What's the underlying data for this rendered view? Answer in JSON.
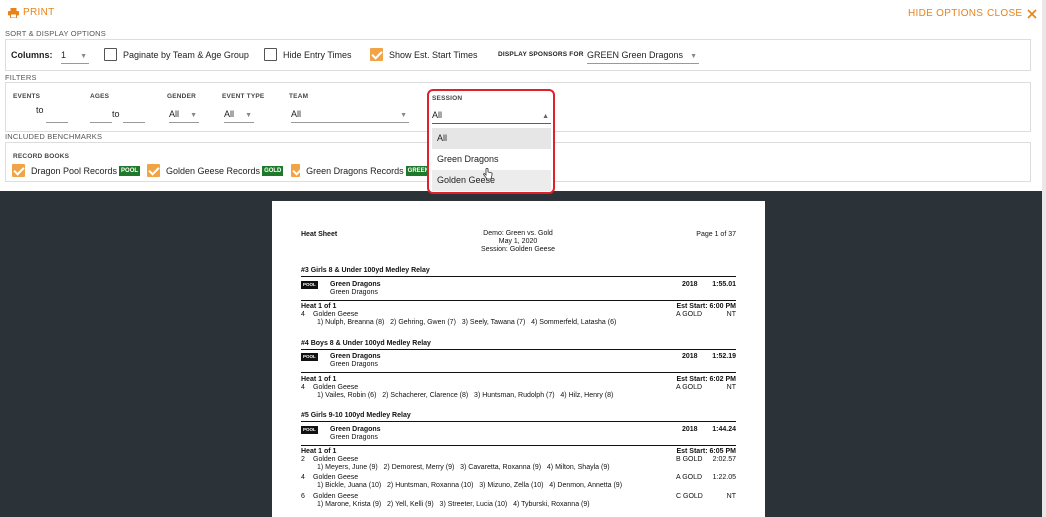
{
  "toolbar": {
    "print_label": "PRINT",
    "hide_options_label": "HIDE OPTIONS",
    "close_label": "CLOSE"
  },
  "sort_display": {
    "section_label": "SORT & DISPLAY OPTIONS",
    "columns_label": "Columns:",
    "columns_value": "1",
    "paginate_label": "Paginate by Team & Age Group",
    "paginate_checked": false,
    "hide_entry_times_label": "Hide Entry Times",
    "hide_entry_times_checked": false,
    "show_est_label": "Show Est. Start Times",
    "show_est_checked": true,
    "sponsors_label": "DISPLAY SPONSORS FOR",
    "sponsors_value": "GREEN Green Dragons"
  },
  "filters": {
    "section_label": "FILTERS",
    "events_label": "EVENTS",
    "events_to": "to",
    "ages_label": "AGES",
    "ages_to": "to",
    "gender_label": "GENDER",
    "gender_value": "All",
    "event_type_label": "EVENT TYPE",
    "event_type_value": "All",
    "team_label": "TEAM",
    "team_value": "All",
    "session_label": "SESSION",
    "session_value": "All",
    "session_options": [
      "All",
      "Green Dragons",
      "Golden Geese"
    ]
  },
  "benchmarks": {
    "section_label": "INCLUDED BENCHMARKS",
    "record_books_label": "RECORD BOOKS",
    "items": [
      {
        "label": "Dragon Pool Records",
        "tag": "POOL"
      },
      {
        "label": "Golden Geese Records",
        "tag": "GOLD"
      },
      {
        "label": "Green Dragons Records",
        "tag": "GREEN"
      }
    ]
  },
  "sheet": {
    "title": "Heat Sheet",
    "meet_name": "Demo: Green vs. Gold",
    "meet_date": "May 1, 2020",
    "session_line": "Session: Golden Geese",
    "page": "Page 1 of 37",
    "events": [
      {
        "title": "#3 Girls 8 & Under 100yd Medley Relay",
        "record_tag": "POOL",
        "record_team": "Green Dragons",
        "record_team2": "Green Dragons",
        "record_year": "2018",
        "record_time": "1:55.01",
        "heat": "Heat 1 of 1",
        "est_start": "Est Start: 6:00 PM",
        "lanes": [
          {
            "lane": "4",
            "team": "Golden Geese",
            "entry": "A GOLD",
            "time": "NT",
            "swimmers": "1) Nulph, Breanna (8)   2) Gehring, Gwen (7)   3) Seely, Tawana (7)   4) Sommerfeld, Latasha (6)"
          }
        ]
      },
      {
        "title": "#4 Boys 8 & Under 100yd Medley Relay",
        "record_tag": "POOL",
        "record_team": "Green Dragons",
        "record_team2": "Green Dragons",
        "record_year": "2018",
        "record_time": "1:52.19",
        "heat": "Heat 1 of 1",
        "est_start": "Est Start: 6:02 PM",
        "lanes": [
          {
            "lane": "4",
            "team": "Golden Geese",
            "entry": "A GOLD",
            "time": "NT",
            "swimmers": "1) Vailes, Robin (6)   2) Schacherer, Clarence (8)   3) Huntsman, Rudolph (7)   4) Hilz, Henry (8)"
          }
        ]
      },
      {
        "title": "#5 Girls 9-10 100yd Medley Relay",
        "record_tag": "POOL",
        "record_team": "Green Dragons",
        "record_team2": "Green Dragons",
        "record_year": "2018",
        "record_time": "1:44.24",
        "heat": "Heat 1 of 1",
        "est_start": "Est Start: 6:05 PM",
        "lanes": [
          {
            "lane": "2",
            "team": "Golden Geese",
            "entry": "B GOLD",
            "time": "2:02.57",
            "swimmers": "1) Meyers, June (9)   2) Demorest, Merry (9)   3) Cavaretta, Roxanna (9)   4) Milton, Shayla (9)"
          },
          {
            "lane": "4",
            "team": "Golden Geese",
            "entry": "A GOLD",
            "time": "1:22.05",
            "swimmers": "1) Bickle, Juana (10)   2) Huntsman, Roxanna (10)   3) Mizuno, Zella (10)   4) Denmon, Annetta (9)"
          },
          {
            "lane": "6",
            "team": "Golden Geese",
            "entry": "C GOLD",
            "time": "NT",
            "swimmers": "1) Marone, Krista (9)   2) Yell, Kelli (9)   3) Streeter, Lucia (10)   4) Tyburski, Roxanna (9)"
          }
        ]
      }
    ]
  }
}
